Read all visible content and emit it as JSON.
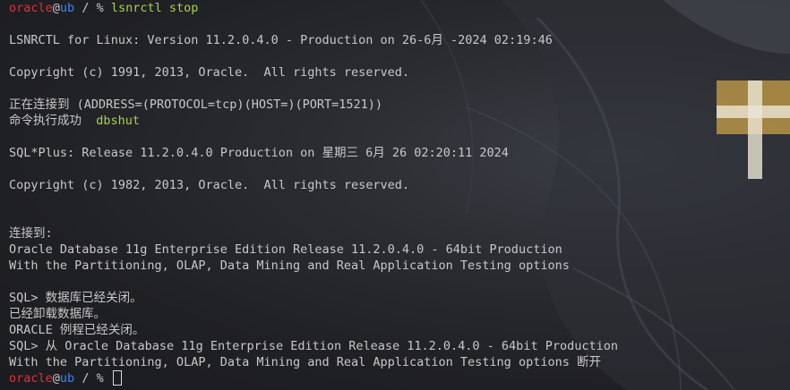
{
  "prompt": {
    "user": "oracle",
    "at": "@",
    "host": "ub",
    "path": " / % "
  },
  "lines": {
    "l1_cmd": "lsnrctl stop",
    "l2": "LSNRCTL for Linux: Version 11.2.0.4.0 - Production on 26-6月 -2024 02:19:46",
    "l3": "Copyright (c) 1991, 2013, Oracle.  All rights reserved.",
    "l4": "正在连接到 (ADDRESS=(PROTOCOL=tcp)(HOST=)(PORT=1521))",
    "l5_text": "命令执行成功  ",
    "l5_cmd": "dbshut",
    "l6": "SQL*Plus: Release 11.2.0.4.0 Production on 星期三 6月 26 02:20:11 2024",
    "l7": "Copyright (c) 1982, 2013, Oracle.  All rights reserved.",
    "l8": "连接到:",
    "l9": "Oracle Database 11g Enterprise Edition Release 11.2.0.4.0 - 64bit Production",
    "l10": "With the Partitioning, OLAP, Data Mining and Real Application Testing options",
    "l11": "SQL> 数据库已经关闭。",
    "l12": "已经卸载数据库。",
    "l13": "ORACLE 例程已经关闭。",
    "l14": "SQL> 从 Oracle Database 11g Enterprise Edition Release 11.2.0.4.0 - 64bit Production",
    "l15": "With the Partitioning, OLAP, Data Mining and Real Application Testing options 断开"
  }
}
